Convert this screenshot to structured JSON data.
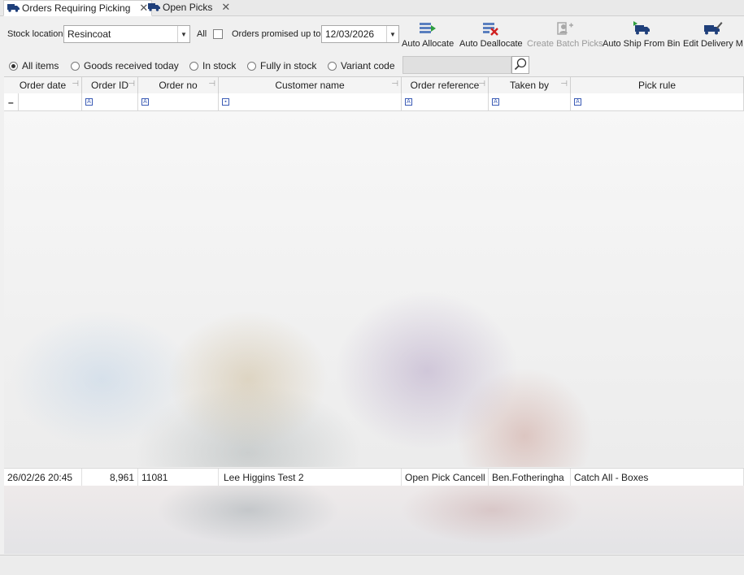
{
  "tabs": [
    {
      "label": "Orders Requiring Picking",
      "active": true
    },
    {
      "label": "Open Picks",
      "active": false
    }
  ],
  "toolbar": {
    "stock_location_label": "Stock location",
    "stock_location_value": "Resincoat",
    "all_label": "All",
    "orders_promised_label": "Orders promised up to",
    "promised_date": "12/03/2026",
    "buttons": {
      "auto_allocate": "Auto Allocate",
      "auto_deallocate": "Auto Deallocate",
      "create_batch_picks": "Create Batch Picks",
      "auto_ship_from_bin": "Auto Ship From Bin",
      "edit_delivery": "Edit Delivery M"
    }
  },
  "filters": {
    "all_items": "All items",
    "goods_received_today": "Goods received today",
    "in_stock": "In stock",
    "fully_in_stock": "Fully in stock",
    "variant_code": "Variant code",
    "selected": "All items"
  },
  "grid": {
    "columns": {
      "order_date": "Order date",
      "order_id": "Order ID",
      "order_no": "Order no",
      "customer_name": "Customer name",
      "order_reference": "Order reference",
      "taken_by": "Taken by",
      "pick_rule": "Pick rule"
    },
    "row": {
      "order_date": "26/02/26 20:45",
      "order_id": "8,961",
      "order_no": "11081",
      "customer_name": "Lee Higgins Test 2",
      "order_reference": "Open Pick Cancell",
      "taken_by": "Ben.Fotheringha",
      "pick_rule": "Catch All - Boxes"
    }
  },
  "colors": {
    "accent": "#1f3f7a",
    "allocate_green": "#2e9e3e",
    "dealloc_red": "#d02020"
  }
}
